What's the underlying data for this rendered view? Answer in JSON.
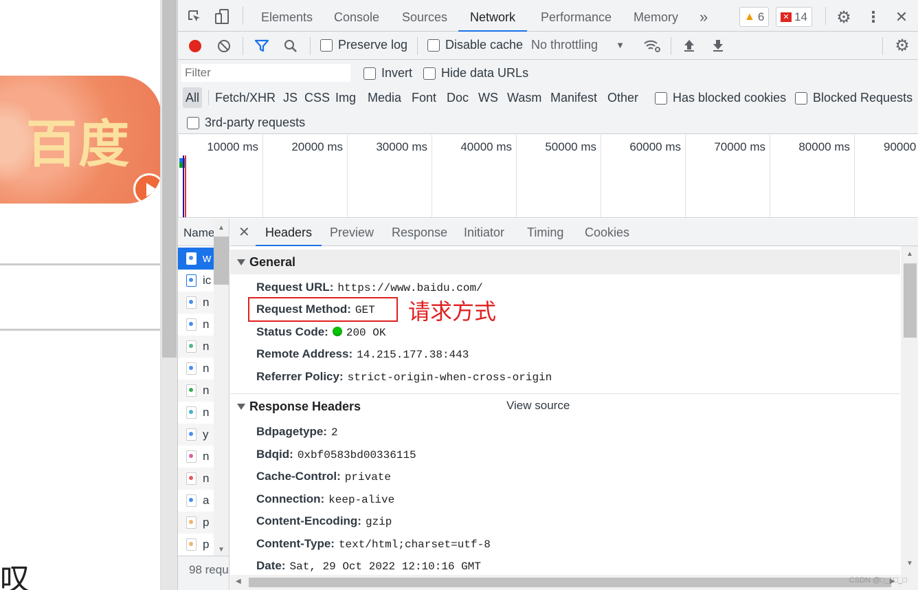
{
  "page": {
    "logo_text": "百度",
    "cutoff_glyph": "叹"
  },
  "devtools": {
    "tabs": [
      "Elements",
      "Console",
      "Sources",
      "Network",
      "Performance",
      "Memory"
    ],
    "active_tab": "Network",
    "more_tabs": "»",
    "warnings_count": "6",
    "errors_count": "14",
    "toolbar": {
      "preserve_log": "Preserve log",
      "disable_cache": "Disable cache",
      "throttling": "No throttling"
    },
    "filter": {
      "placeholder": "Filter",
      "invert": "Invert",
      "hide_data_urls": "Hide data URLs",
      "types": [
        "All",
        "Fetch/XHR",
        "JS",
        "CSS",
        "Img",
        "Media",
        "Font",
        "Doc",
        "WS",
        "Wasm",
        "Manifest",
        "Other"
      ],
      "has_blocked_cookies": "Has blocked cookies",
      "blocked_requests": "Blocked Requests",
      "third_party": "3rd-party requests"
    },
    "timeline_ticks": [
      "10000 ms",
      "20000 ms",
      "30000 ms",
      "40000 ms",
      "50000 ms",
      "60000 ms",
      "70000 ms",
      "80000 ms",
      "90000 ms"
    ],
    "requests": {
      "header": "Name",
      "rows": [
        "w",
        "ic",
        "n",
        "n",
        "n",
        "n",
        "n",
        "n",
        "y",
        "n",
        "n",
        "a",
        "p",
        "p"
      ],
      "footer": "98 requ"
    },
    "detail": {
      "tabs": [
        "Headers",
        "Preview",
        "Response",
        "Initiator",
        "Timing",
        "Cookies"
      ],
      "active_tab": "Headers",
      "general": {
        "title": "General",
        "request_url_label": "Request URL:",
        "request_url": "https://www.baidu.com/",
        "method_label": "Request Method:",
        "method": "GET",
        "status_label": "Status Code:",
        "status": "200 OK",
        "remote_label": "Remote Address:",
        "remote": "14.215.177.38:443",
        "referrer_label": "Referrer Policy:",
        "referrer": "strict-origin-when-cross-origin"
      },
      "annotation": "请求方式",
      "response_headers": {
        "title": "Response Headers",
        "view_source": "View source",
        "items": [
          {
            "k": "Bdpagetype:",
            "v": "2"
          },
          {
            "k": "Bdqid:",
            "v": "0xbf0583bd00336115"
          },
          {
            "k": "Cache-Control:",
            "v": "private"
          },
          {
            "k": "Connection:",
            "v": "keep-alive"
          },
          {
            "k": "Content-Encoding:",
            "v": "gzip"
          },
          {
            "k": "Content-Type:",
            "v": "text/html;charset=utf-8"
          },
          {
            "k": "Date:",
            "v": "Sat, 29 Oct 2022 12:10:16 GMT"
          }
        ]
      }
    },
    "watermark": "CSDN @□_□□_□",
    "colors": {
      "accent": "#1a73e8",
      "record": "#e0261f",
      "annotation": "#e02020",
      "status_ok": "#0ac20a"
    }
  }
}
